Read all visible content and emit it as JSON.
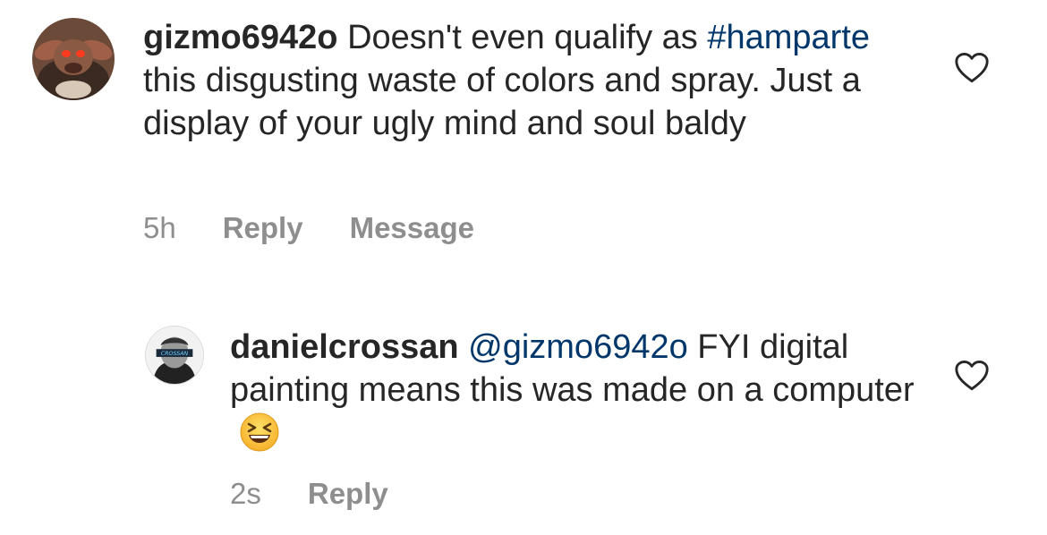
{
  "comments": [
    {
      "username": "gizmo6942o",
      "text_before": " Doesn't even qualify as ",
      "hashtag": "#hamparte",
      "text_after": " this disgusting waste of colors and spray. Just a display of your ugly mind and soul baldy",
      "time": "5h",
      "reply_label": "Reply",
      "message_label": "Message",
      "avatar": "gremlin-avatar",
      "like_icon": "heart-outline-icon"
    },
    {
      "username": "danielcrossan",
      "mention": "@gizmo6942o",
      "text": " FYI digital painting means this was made on a computer",
      "emoji": "grinning-squinting-face-emoji",
      "time": "2s",
      "reply_label": "Reply",
      "avatar": "danielcrossan-avatar",
      "avatar_text": "CROSSAN",
      "like_icon": "heart-outline-icon"
    }
  ],
  "colors": {
    "text": "#262626",
    "secondary": "#8e8e8e",
    "link": "#00376b"
  }
}
